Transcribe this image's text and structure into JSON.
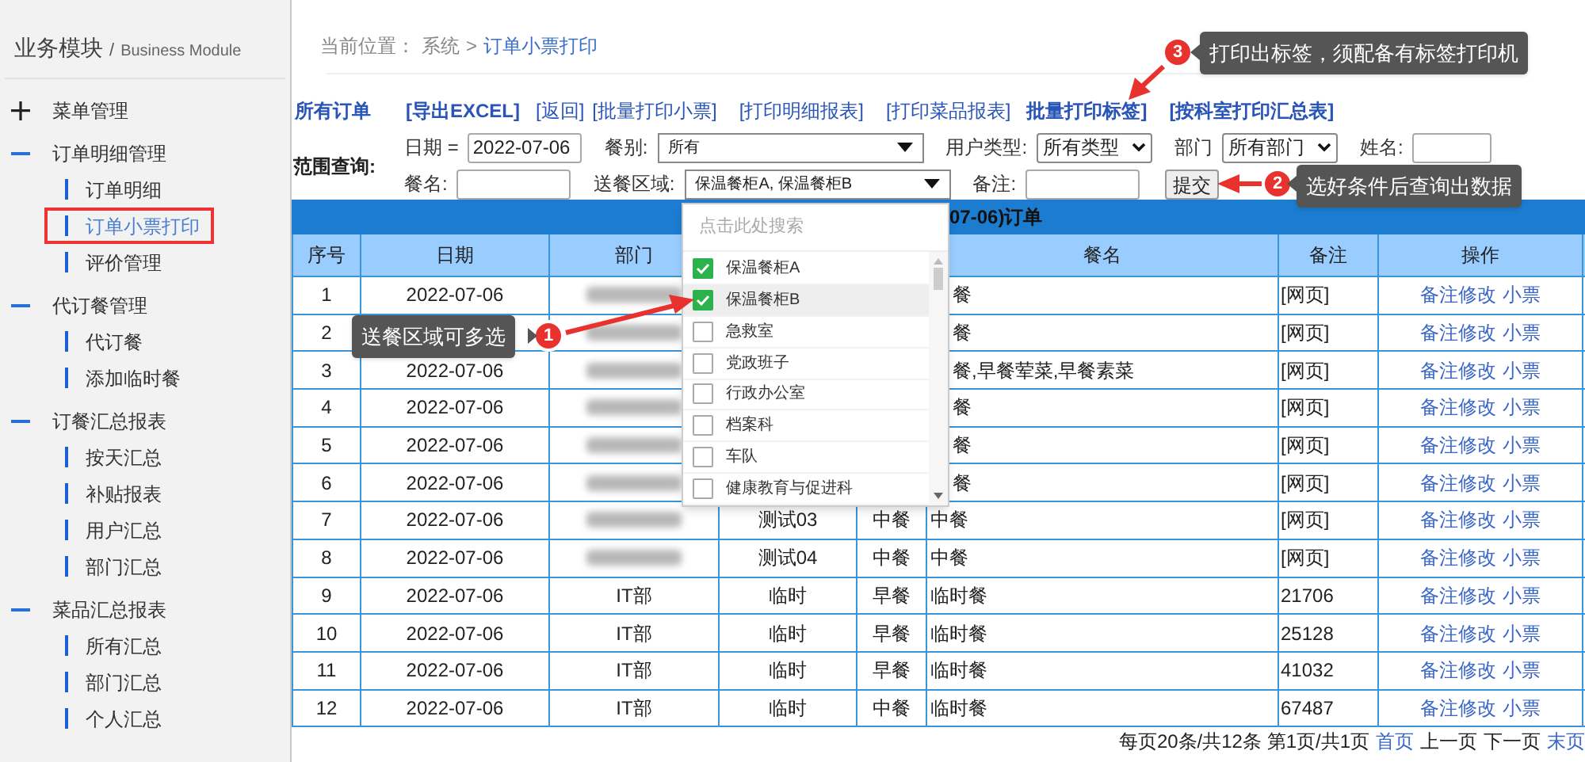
{
  "sidebar": {
    "title": "业务模块",
    "separator": "/",
    "subtitle": "Business Module",
    "groups": [
      {
        "label": "菜单管理",
        "expanded": false
      },
      {
        "label": "订单明细管理",
        "expanded": true,
        "children": [
          {
            "label": "订单明细",
            "selected": false
          },
          {
            "label": "订单小票打印",
            "selected": true
          },
          {
            "label": "评价管理",
            "selected": false
          }
        ]
      },
      {
        "label": "代订餐管理",
        "expanded": true,
        "children": [
          {
            "label": "代订餐",
            "selected": false
          },
          {
            "label": "添加临时餐",
            "selected": false
          }
        ]
      },
      {
        "label": "订餐汇总报表",
        "expanded": true,
        "children": [
          {
            "label": "按天汇总",
            "selected": false
          },
          {
            "label": "补贴报表",
            "selected": false
          },
          {
            "label": "用户汇总",
            "selected": false
          },
          {
            "label": "部门汇总",
            "selected": false
          }
        ]
      },
      {
        "label": "菜品汇总报表",
        "expanded": true,
        "children": [
          {
            "label": "所有汇总",
            "selected": false
          },
          {
            "label": "部门汇总",
            "selected": false
          },
          {
            "label": "个人汇总",
            "selected": false
          }
        ]
      }
    ]
  },
  "breadcrumb": {
    "label": "当前位置：",
    "path": [
      "系统",
      "订单小票打印"
    ],
    "separator": ">"
  },
  "toolbar": [
    {
      "label": "所有订单",
      "bold": true
    },
    {
      "label": "[导出EXCEL]",
      "bold": true
    },
    {
      "label": "[返回]",
      "bold": false
    },
    {
      "label": "[批量打印小票]",
      "bold": false
    },
    {
      "label": "[打印明细报表]",
      "bold": false
    },
    {
      "label": "[打印菜品报表]",
      "bold": false
    },
    {
      "label": "批量打印标签]",
      "bold": true
    },
    {
      "label": "[按科室打印汇总表]",
      "bold": true
    }
  ],
  "query": {
    "label": "范围查询:",
    "rows": [
      [
        {
          "kind": "label",
          "text": "日期 ="
        },
        {
          "kind": "input",
          "value": "2022-07-06"
        },
        {
          "kind": "label",
          "text": "餐别:"
        },
        {
          "kind": "combo",
          "value": "所有"
        },
        {
          "kind": "label",
          "text": "用户类型:"
        },
        {
          "kind": "select",
          "value": "所有类型"
        },
        {
          "kind": "label",
          "text": "部门"
        },
        {
          "kind": "select",
          "value": "所有部门"
        },
        {
          "kind": "label",
          "text": "姓名:"
        },
        {
          "kind": "input-small"
        }
      ],
      [
        {
          "kind": "label",
          "text": "餐名:"
        },
        {
          "kind": "input"
        },
        {
          "kind": "label",
          "text": "送餐区域:"
        },
        {
          "kind": "combo",
          "value": "保温餐柜A, 保温餐柜B"
        },
        {
          "kind": "label",
          "text": "备注:"
        },
        {
          "kind": "input"
        },
        {
          "kind": "button",
          "text": "提交"
        }
      ]
    ]
  },
  "dropdown": {
    "placeholder": "点击此处搜索",
    "options": [
      {
        "label": "保温餐柜A",
        "checked": true,
        "hovered": false
      },
      {
        "label": "保温餐柜B",
        "checked": true,
        "hovered": true
      },
      {
        "label": "急救室",
        "checked": false,
        "hovered": false
      },
      {
        "label": "党政班子",
        "checked": false,
        "hovered": false
      },
      {
        "label": "行政办公室",
        "checked": false,
        "hovered": false
      },
      {
        "label": "档案科",
        "checked": false,
        "hovered": false
      },
      {
        "label": "车队",
        "checked": false,
        "hovered": false
      },
      {
        "label": "健康教育与促进科",
        "checked": false,
        "hovered": false
      }
    ]
  },
  "table": {
    "title": "07-06)订单",
    "columns": [
      "序号",
      "日期",
      "部门",
      null,
      null,
      "餐名",
      "备注",
      "操作"
    ],
    "rows": [
      {
        "no": "1",
        "date": "2022-07-06",
        "dept_blurred": true,
        "meal_name": "餐",
        "name_cut": true,
        "remark": "[网页]",
        "actions": [
          "备注修改",
          "小票"
        ]
      },
      {
        "no": "2",
        "dept_blurred": true,
        "meal_name": "餐",
        "name_cut": true,
        "remark": "[网页]",
        "actions": [
          "备注修改",
          "小票"
        ]
      },
      {
        "no": "3",
        "date": "2022-07-06",
        "dept_blurred": true,
        "meal_name": "餐,早餐荤菜,早餐素菜",
        "name_cut": true,
        "remark": "[网页]",
        "actions": [
          "备注修改",
          "小票"
        ]
      },
      {
        "no": "4",
        "date": "2022-07-06",
        "dept_blurred": true,
        "meal_name": "餐",
        "name_cut": true,
        "remark": "[网页]",
        "actions": [
          "备注修改",
          "小票"
        ]
      },
      {
        "no": "5",
        "date": "2022-07-06",
        "dept_blurred": true,
        "meal_name": "餐",
        "name_cut": true,
        "remark": "[网页]",
        "actions": [
          "备注修改",
          "小票"
        ]
      },
      {
        "no": "6",
        "date": "2022-07-06",
        "dept_blurred": true,
        "meal_name": "餐",
        "name_cut": true,
        "remark": "[网页]",
        "actions": [
          "备注修改",
          "小票"
        ]
      },
      {
        "no": "7",
        "date": "2022-07-06",
        "dept_blurred": true,
        "column_4": "测试03",
        "column_5": "中餐",
        "meal_name": "中餐",
        "name_cut": false,
        "remark": "[网页]",
        "actions": [
          "备注修改",
          "小票"
        ]
      },
      {
        "no": "8",
        "date": "2022-07-06",
        "dept_blurred": true,
        "column_4": "测试04",
        "column_5": "中餐",
        "meal_name": "中餐",
        "name_cut": false,
        "remark": "[网页]",
        "actions": [
          "备注修改",
          "小票"
        ]
      },
      {
        "no": "9",
        "date": "2022-07-06",
        "dept": "IT部",
        "dept_blurred": false,
        "column_4": "临时",
        "column_5": "早餐",
        "meal_name": "临时餐",
        "remark": "21706",
        "actions": [
          "备注修改",
          "小票"
        ]
      },
      {
        "no": "10",
        "date": "2022-07-06",
        "dept": "IT部",
        "dept_blurred": false,
        "column_4": "临时",
        "column_5": "早餐",
        "meal_name": "临时餐",
        "remark": "25128",
        "actions": [
          "备注修改",
          "小票"
        ]
      },
      {
        "no": "11",
        "date": "2022-07-06",
        "dept": "IT部",
        "dept_blurred": false,
        "column_4": "临时",
        "column_5": "早餐",
        "meal_name": "临时餐",
        "remark": "41032",
        "actions": [
          "备注修改",
          "小票"
        ]
      },
      {
        "no": "12",
        "date": "2022-07-06",
        "dept": "IT部",
        "dept_blurred": false,
        "column_4": "临时",
        "column_5": "中餐",
        "meal_name": "临时餐",
        "remark": "67487",
        "actions": [
          "备注修改",
          "小票"
        ]
      }
    ]
  },
  "pagination": {
    "summary": "每页20条/共12条 第1页/共1页",
    "links": [
      {
        "label": "首页",
        "disabled": false
      },
      {
        "label": "上一页",
        "disabled": true
      },
      {
        "label": "下一页",
        "disabled": true
      },
      {
        "label": "末页",
        "disabled": false
      }
    ]
  },
  "annotations": [
    {
      "number": "3",
      "text": "打印出标签，须配备有标签打印机"
    },
    {
      "number": "2",
      "text": "选好条件后查询出数据"
    },
    {
      "number": "1",
      "text": "送餐区域可多选"
    }
  ]
}
